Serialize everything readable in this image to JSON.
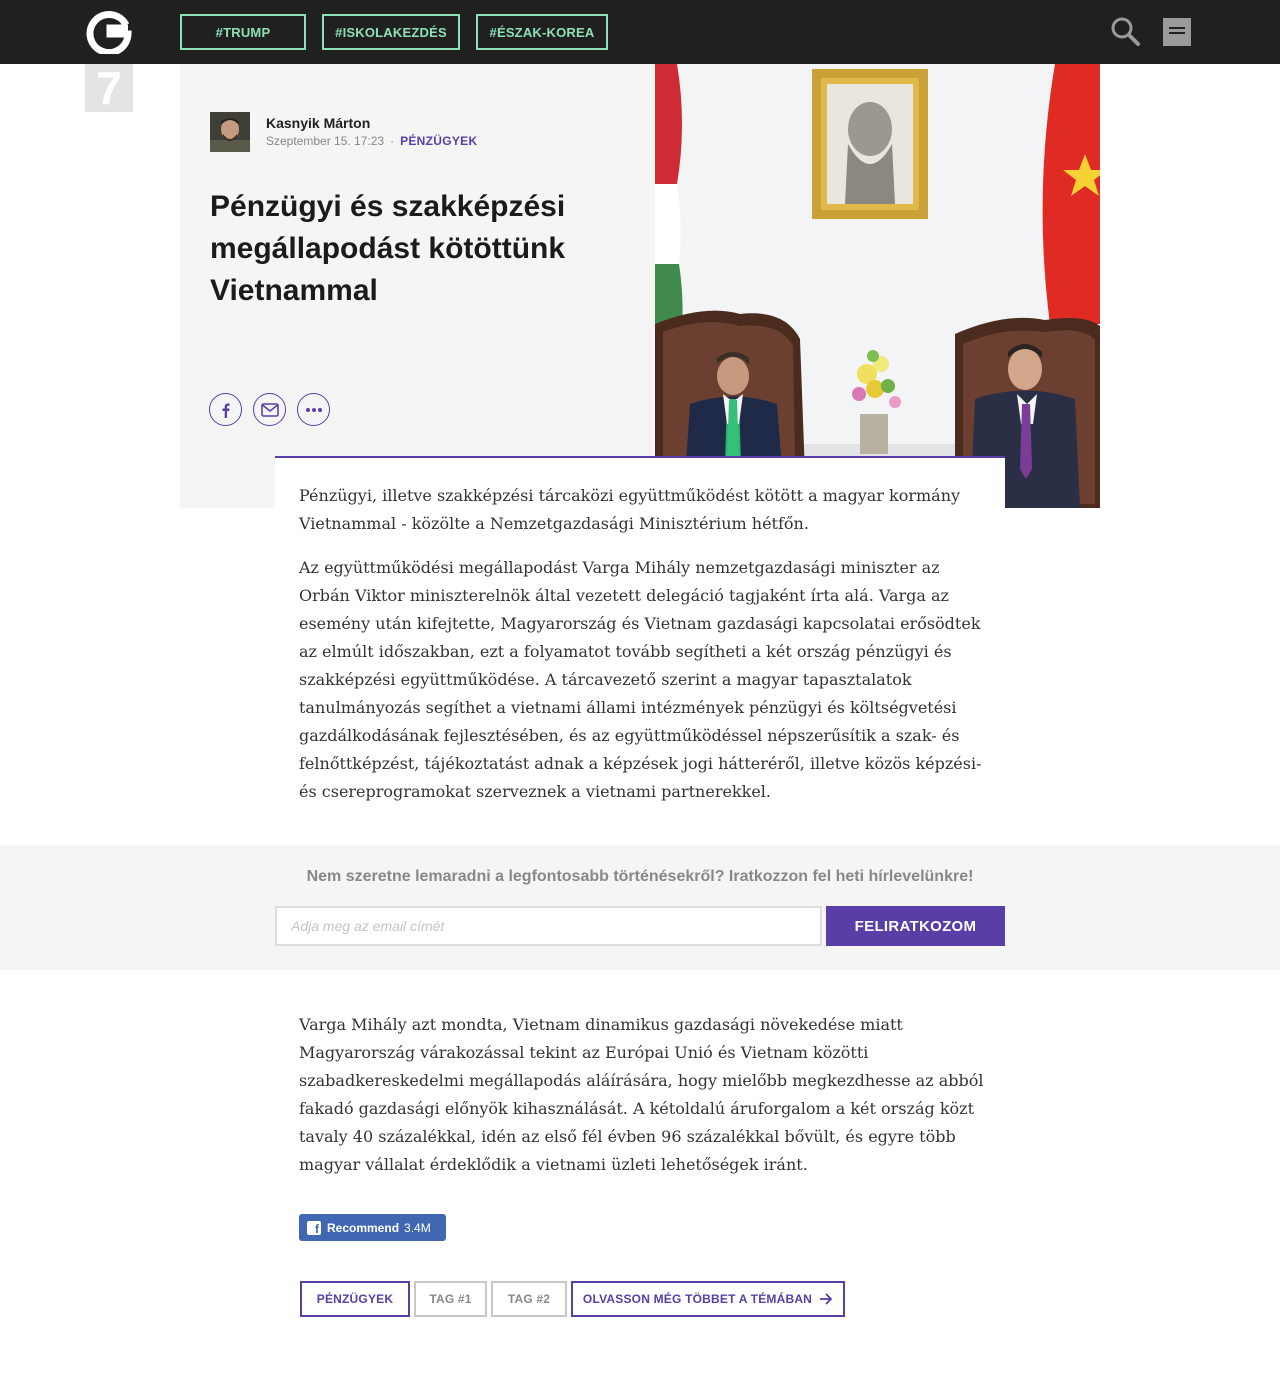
{
  "nav": {
    "logo": "G",
    "tags": [
      "#TRUMP",
      "#ISKOLAKEZDÉS",
      "#ÉSZAK-KOREA"
    ],
    "search_icon": "search-icon",
    "menu_icon": "hamburger-menu-icon"
  },
  "badge": {
    "number": "7"
  },
  "article": {
    "author": "Kasnyik Márton",
    "date": "Szeptember 15. 17:23",
    "separator": "·",
    "category": "PÉNZÜGYEK",
    "title": "Pénzügyi és szakképzési megállapodást kötöttünk Vietnammal",
    "share_icons": [
      "facebook-icon",
      "mail-icon",
      "more-icon"
    ],
    "paragraphs": [
      "Pénzügyi, illetve szakképzési tárcaközi együttműködést kötött a magyar kormány Vietnammal - közölte a Nemzetgazdasági Minisztérium hétfőn.",
      "Az együttműködési megállapodást Varga Mihály nemzetgazdasági miniszter az Orbán Viktor miniszterelnök által vezetett delegáció tagjaként írta alá. Varga az esemény után kifejtette, Magyarország és Vietnam gazdasági kapcsolatai erősödtek az elmúlt időszakban, ezt a folyamatot tovább segítheti a két ország pénzügyi és szakképzési együttműködése. A tárcavezető szerint a magyar tapasztalatok tanulmányozás segíthet a vietnami állami intézmények pénzügyi és költségvetési gazdálkodásának fejlesztésében, és az együttműködéssel népszerűsítik a szak- és felnőttképzést, tájékoztatást adnak a képzések jogi hátteréről, illetve közös képzési- és csereprogramokat szerveznek a vietnami partnerekkel.",
      "Varga Mihály azt mondta, Vietnam dinamikus gazdasági növekedése miatt Magyarország várakozással tekint az Európai Unió és Vietnam közötti szabadkereskedelmi megállapodás aláírására, hogy mielőbb megkezdhesse az abból fakadó gazdasági előnyök kihasználását. A kétoldalú áruforgalom a két ország közt tavaly 40 százalékkal, idén az első fél évben 96 százalékkal bővült, és egyre több magyar vállalat érdeklődik a vietnami üzleti lehetőségek iránt."
    ]
  },
  "newsletter": {
    "title": "Nem szeretne lemaradni a legfontosabb történésekről? Iratkozzon fel heti hírlevelünkre!",
    "placeholder": "Adja meg az email címét",
    "button": "FELIRATKOZOM"
  },
  "facebook": {
    "label": "Recommend",
    "count": "3.4M"
  },
  "bottom_tags": {
    "category": "PÉNZÜGYEK",
    "tag1": "TAG #1",
    "tag2": "TAG #2",
    "more": "OLVASSON MÉG TÖBBET A TÉMÁBAN"
  },
  "colors": {
    "accent": "#5a3ea8",
    "nav_bg": "#202020",
    "tag_green": "#8ee0b8",
    "facebook": "#4267b2"
  }
}
